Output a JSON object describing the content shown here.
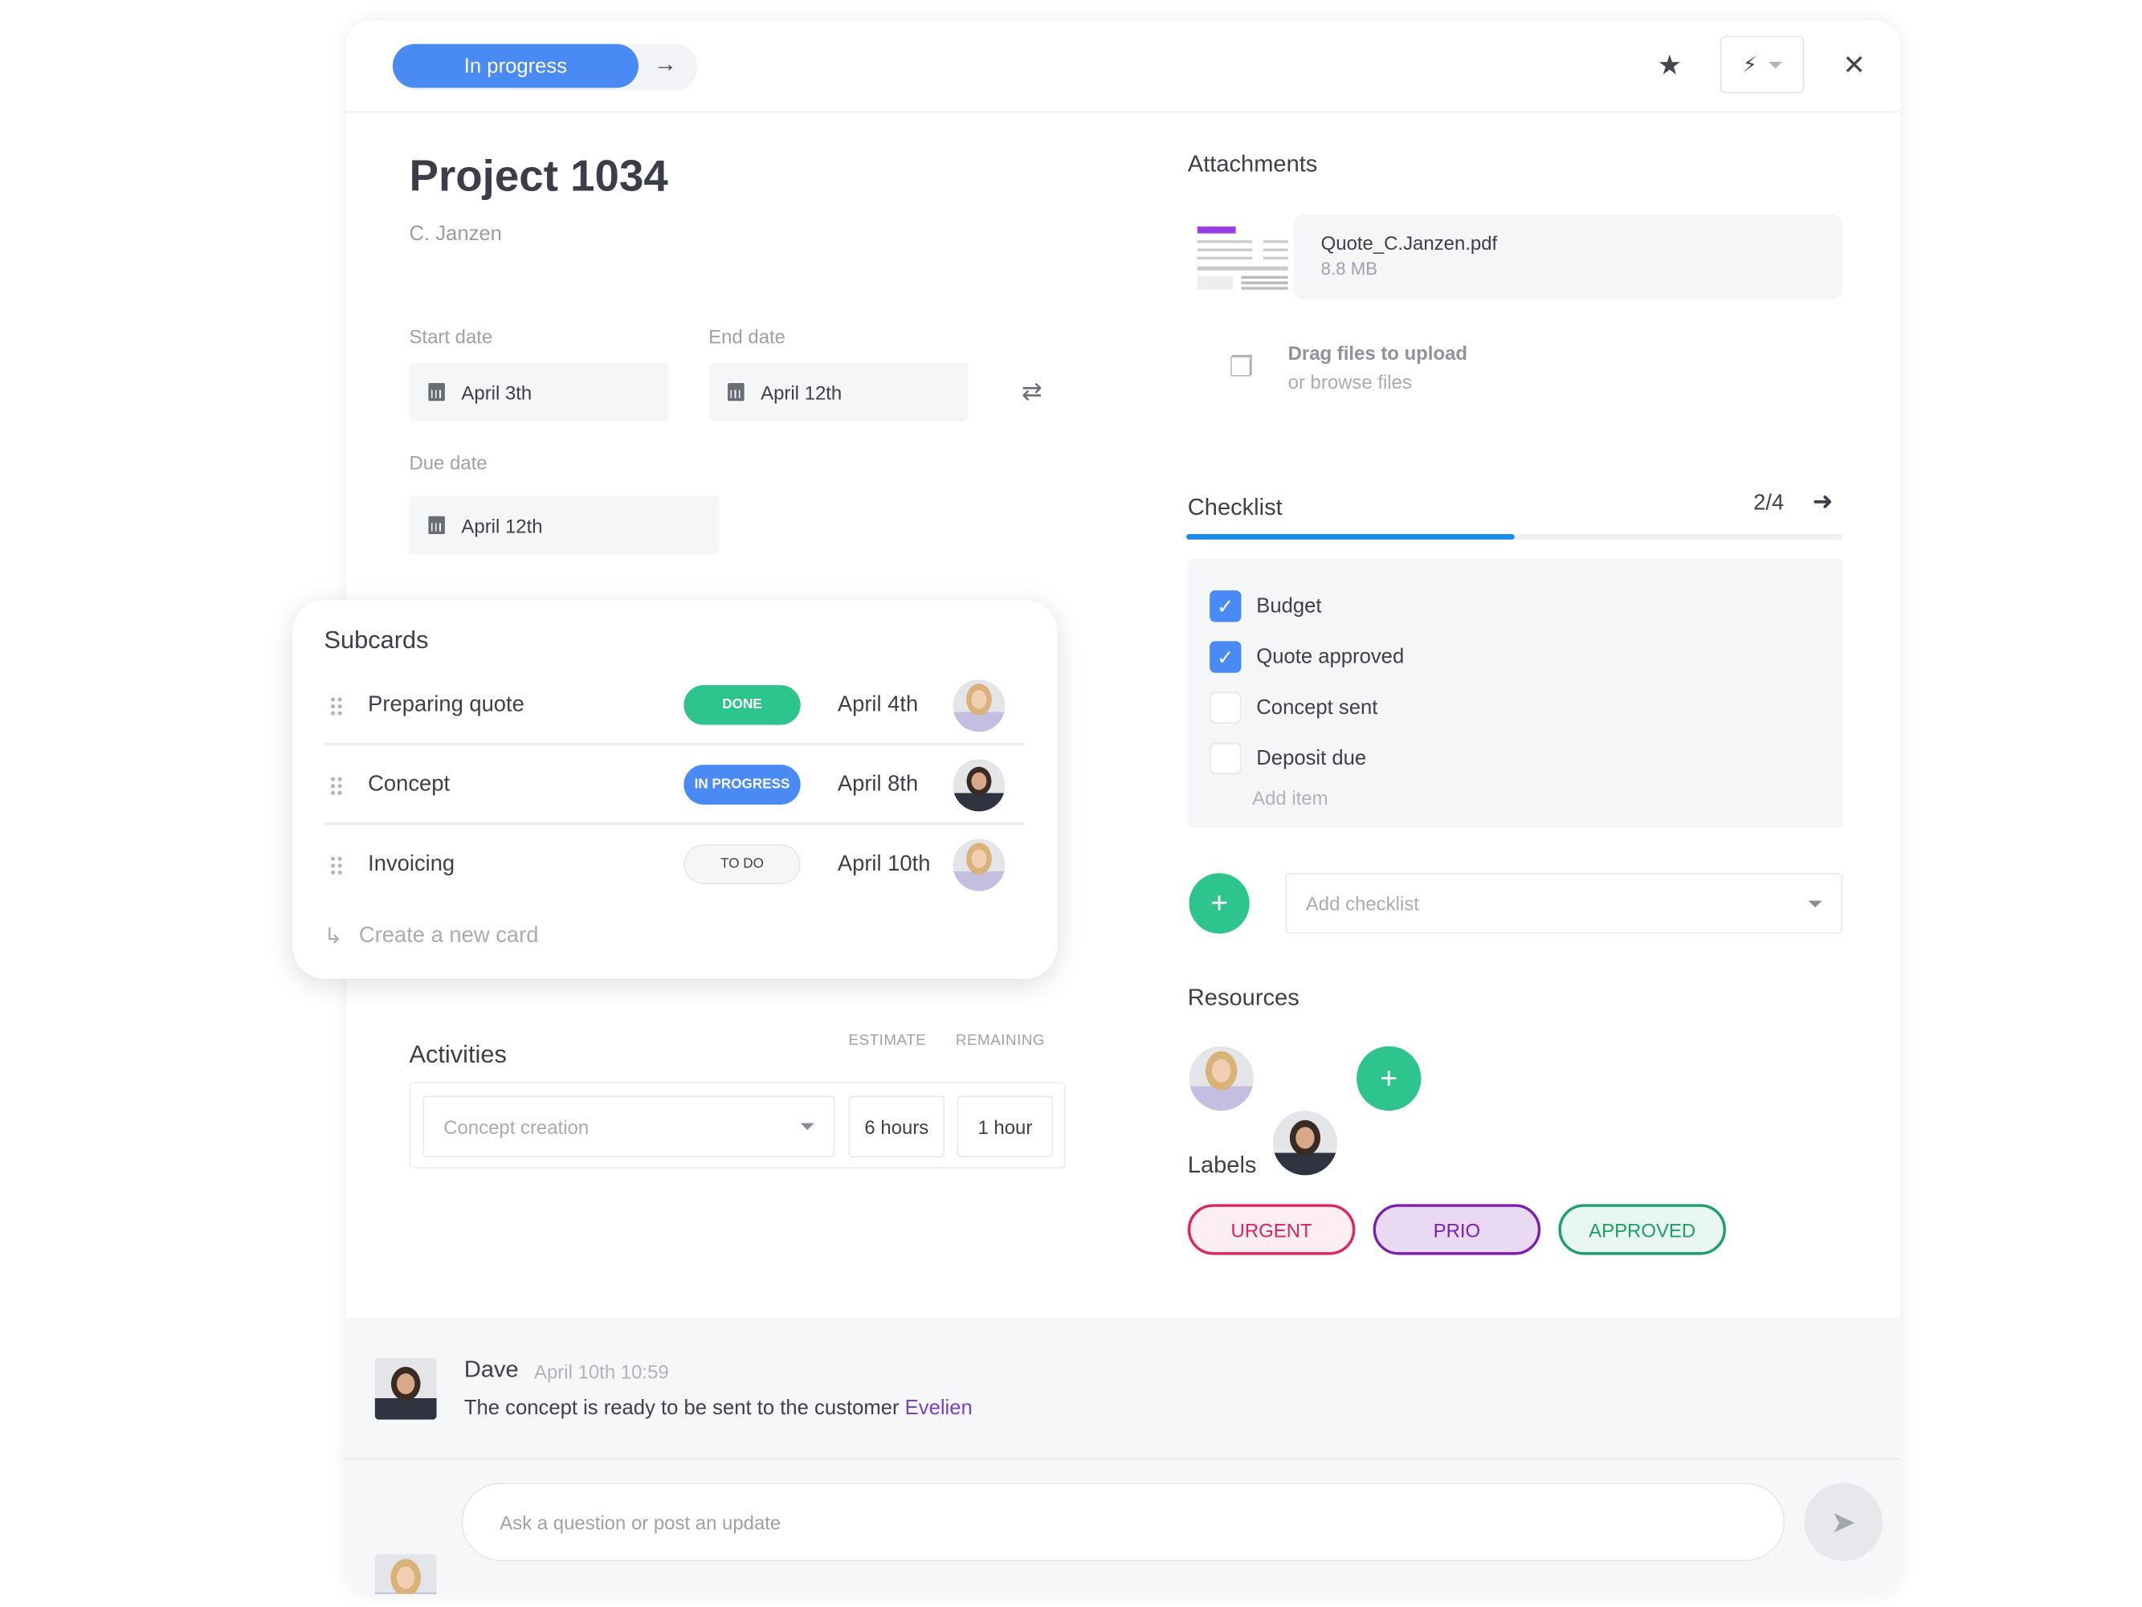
{
  "header": {
    "status": "In progress",
    "icons": [
      "arrow-right-icon",
      "star-icon",
      "bolt-icon",
      "close-icon"
    ]
  },
  "project": {
    "title": "Project 1034",
    "client": "C. Janzen"
  },
  "dates": {
    "start_label": "Start date",
    "start_value": "April 3th",
    "end_label": "End date",
    "end_value": "April 12th",
    "due_label": "Due date",
    "due_value": "April 12th"
  },
  "subcards": {
    "title": "Subcards",
    "items": [
      {
        "name": "Preparing quote",
        "status": "DONE",
        "date": "April 4th"
      },
      {
        "name": "Concept",
        "status": "IN PROGRESS",
        "date": "April 8th"
      },
      {
        "name": "Invoicing",
        "status": "TO DO",
        "date": "April 10th"
      }
    ],
    "create": "Create a new card"
  },
  "activities": {
    "title": "Activities",
    "col_estimate": "ESTIMATE",
    "col_remaining": "REMAINING",
    "activity": "Concept creation",
    "estimate": "6 hours",
    "remaining": "1 hour"
  },
  "attachments": {
    "title": "Attachments",
    "file_name": "Quote_C.Janzen.pdf",
    "file_size": "8.8 MB",
    "upload_line1": "Drag files to upload",
    "upload_line2": "or browse files"
  },
  "checklist": {
    "title": "Checklist",
    "count": "2/4",
    "progress": 0.5,
    "items": [
      {
        "label": "Budget",
        "checked": true
      },
      {
        "label": "Quote approved",
        "checked": true
      },
      {
        "label": "Concept sent",
        "checked": false
      },
      {
        "label": "Deposit due",
        "checked": false
      }
    ],
    "add_item": "Add item",
    "add_checklist_placeholder": "Add checklist"
  },
  "resources": {
    "title": "Resources"
  },
  "labels": {
    "title": "Labels",
    "items": [
      {
        "text": "URGENT",
        "color": "#e0245e",
        "bg": "#fdeef2"
      },
      {
        "text": "PRIO",
        "color": "#7b1fb0",
        "bg": "#ead9f3"
      },
      {
        "text": "APPROVED",
        "color": "#1e9e6a",
        "bg": "#e8f7f0"
      }
    ]
  },
  "comment": {
    "author": "Dave",
    "time": "April 10th 10:59",
    "text": "The concept is ready to be sent to the customer ",
    "mention": "Evelien",
    "mention_color": "#7b3fc4"
  },
  "composer": {
    "placeholder": "Ask a question or post an update"
  },
  "colors": {
    "accent": "#4a8af4",
    "success": "#2dc48d",
    "progress": "#1a8ce6"
  }
}
